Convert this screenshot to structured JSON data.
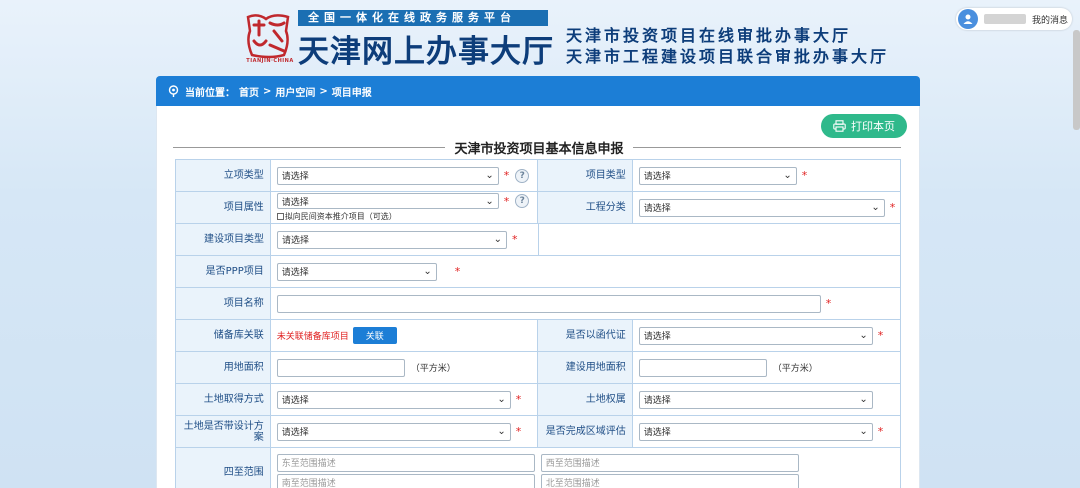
{
  "header": {
    "seal_text": "TIANJIN·CHINA",
    "slogan": "全国一体化在线政务服务平台",
    "site_title": "天津网上办事大厅",
    "subtitle_1": "天津市投资项目在线审批办事大厅",
    "subtitle_2": "天津市工程建设项目联合审批办事大厅",
    "my_messages": "我的消息"
  },
  "breadcrumb": {
    "label": "当前位置：",
    "items": [
      "首页",
      ">",
      "用户空间",
      ">",
      "项目申报"
    ]
  },
  "print_button": "打印本页",
  "form_title": "天津市投资项目基本信息申报",
  "placeholder_select": "请选择",
  "fields": {
    "project_setup_type": "立项类型",
    "project_type": "项目类型",
    "project_attribute": "项目属性",
    "private_capital_option": "拟向民间资本推介项目（可选）",
    "engineering_category": "工程分类",
    "construction_project_type": "建设项目类型",
    "is_ppp": "是否PPP项目",
    "project_name": "项目名称",
    "reserve_link": "储备库关联",
    "reserve_not_linked": "未关联储备库项目",
    "link_button": "关联",
    "letter_as_cert": "是否以函代证",
    "land_area": "用地面积",
    "construction_land_area": "建设用地面积",
    "sqm_unit": "（平方米）",
    "land_acquisition": "土地取得方式",
    "land_ownership": "土地权属",
    "land_has_design": "土地是否带设计方案",
    "regional_assessment": "是否完成区域评估",
    "boundaries": "四至范围",
    "east_placeholder": "东至范围描述",
    "west_placeholder": "西至范围描述",
    "south_placeholder": "南至范围描述",
    "north_placeholder": "北至范围描述"
  },
  "required_mark": "*",
  "help_mark": "?",
  "colors": {
    "primary": "#1c7ed6",
    "print_button": "#2fb98b",
    "required": "#e02020",
    "label_bg": "#eaf3fb"
  }
}
